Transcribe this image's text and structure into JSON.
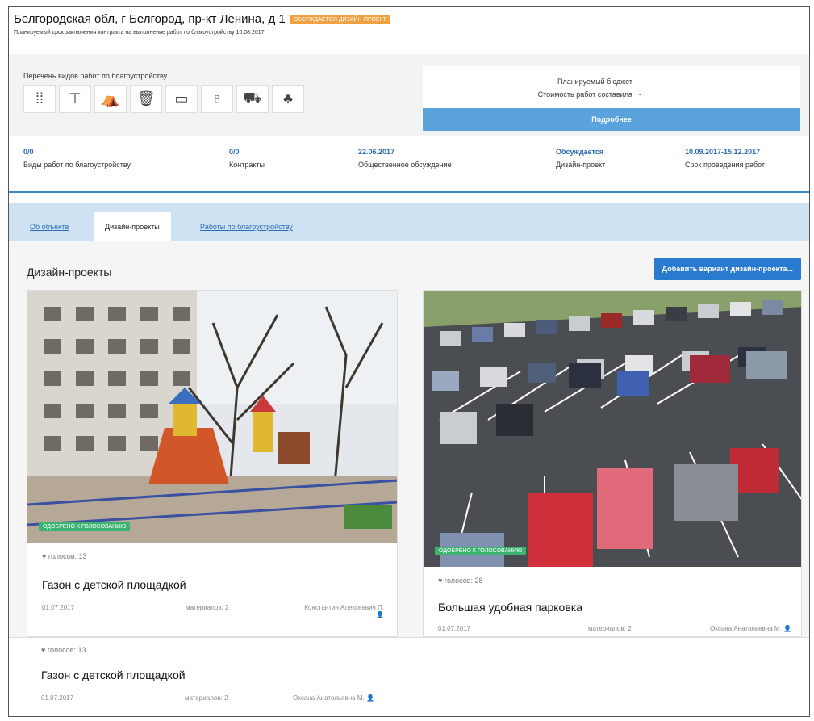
{
  "header": {
    "address": "Белгородская обл, г Белгород, пр-кт Ленина, д 1",
    "badge": "ОБСУЖДАЕТСЯ ДИЗАЙН-ПРОЕКТ",
    "plan_text": "Планируемый срок заключения контракта на выполнение работ по благоустройству 10.08.2017"
  },
  "works": {
    "title": "Перечень видов работ по благоустройству",
    "icons": [
      "bench-icon",
      "lamp-post-icon",
      "playground-icon",
      "trash-bin-icon",
      "fence-icon",
      "street-light-icon",
      "parking-icon",
      "greenery-icon"
    ]
  },
  "budget": {
    "planned_label": "Планируемый бюджет",
    "planned_value": "-",
    "cost_label": "Стоимость работ составила",
    "cost_value": "-",
    "more_label": "Подробнее"
  },
  "stats": [
    {
      "value": "0/0",
      "label": "Виды работ по благоустройству"
    },
    {
      "value": "0/0",
      "label": "Контракты"
    },
    {
      "value": "22.06.2017",
      "label": "Общественное обсуждение"
    },
    {
      "value": "Обсуждается",
      "label": "Дизайн-проект"
    },
    {
      "value": "10.09.2017-15.12.2017",
      "label": "Срок проведения работ"
    }
  ],
  "tabs": [
    {
      "label": "Об объекте",
      "active": false
    },
    {
      "label": "Дизайн-проекты",
      "active": true
    },
    {
      "label": "Работы по благоустройству",
      "active": false
    }
  ],
  "section": {
    "title": "Дизайн-проекты",
    "add_button": "Добавить вариант дизайн-проекта..."
  },
  "cards": [
    {
      "approved": "ОДОБРЕНО К ГОЛОСОВАНИЮ",
      "votes": "голосов: 13",
      "title": "Газон с детской площадкой",
      "date": "01.07.2017",
      "materials": "материалов: 2",
      "author": "Константин Алексеевич П."
    },
    {
      "approved": "ОДОБРЕНО К ГОЛОСОВАНИЮ",
      "votes": "голосов: 28",
      "title": "Большая удобная парковка",
      "date": "01.07.2017",
      "materials": "материалов: 2",
      "author": "Оксана Анатольевна М."
    },
    {
      "votes": "голосов: 13",
      "title": "Газон с детской площадкой",
      "date": "01.07.2017",
      "materials": "материалов: 2",
      "author": "Оксана Анатольевна М."
    }
  ]
}
